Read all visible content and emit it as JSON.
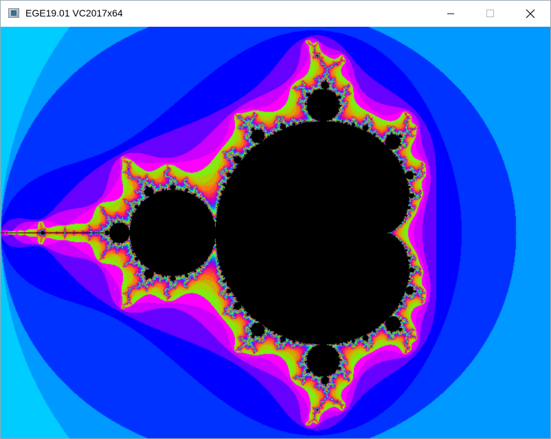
{
  "window": {
    "title": "EGE19.01 VC2017x64",
    "icon": "app-window-icon",
    "controls": {
      "minimize": "minimize-icon",
      "maximize": "maximize-icon",
      "close": "close-icon"
    }
  },
  "content": {
    "view": "Mandelbrot set fractal",
    "background_color": "#00ffff",
    "set_color": "#000000",
    "band_colors": [
      "#00ffff",
      "#00ccff",
      "#0099ff",
      "#0033ff",
      "#0000ff",
      "#6600ff",
      "#cc00ff",
      "#ff00ff"
    ]
  }
}
